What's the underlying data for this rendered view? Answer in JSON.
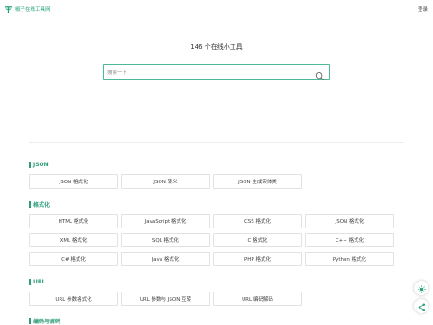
{
  "header": {
    "brand_name": "椒子在线工具网",
    "login_label": "登录"
  },
  "hero": {
    "title": "146 个在线小工具"
  },
  "search": {
    "placeholder": "搜索一下",
    "value": ""
  },
  "sections": [
    {
      "title": "JSON",
      "rows": [
        [
          "JSON 格式化",
          "JSON 转义",
          "JSON 生成实体类"
        ]
      ]
    },
    {
      "title": "格式化",
      "rows": [
        [
          "HTML 格式化",
          "JavaScript 格式化",
          "CSS 格式化",
          "JSON 格式化"
        ],
        [
          "XML 格式化",
          "SQL 格式化",
          "C 格式化",
          "C++ 格式化"
        ],
        [
          "C# 格式化",
          "Java 格式化",
          "PHP 格式化",
          "Python 格式化"
        ]
      ]
    },
    {
      "title": "URL",
      "rows": [
        [
          "URL 参数格式化",
          "URL 参数与 JSON 互转",
          "URL 编码解码"
        ]
      ]
    },
    {
      "title": "编码与解码",
      "rows": []
    }
  ],
  "colors": {
    "accent": "#2d9c7a",
    "search_border": "#4fb89a"
  },
  "icons": {
    "brand": "tree-logo-icon",
    "search": "search-icon",
    "theme": "sun-icon",
    "share": "share-icon"
  }
}
